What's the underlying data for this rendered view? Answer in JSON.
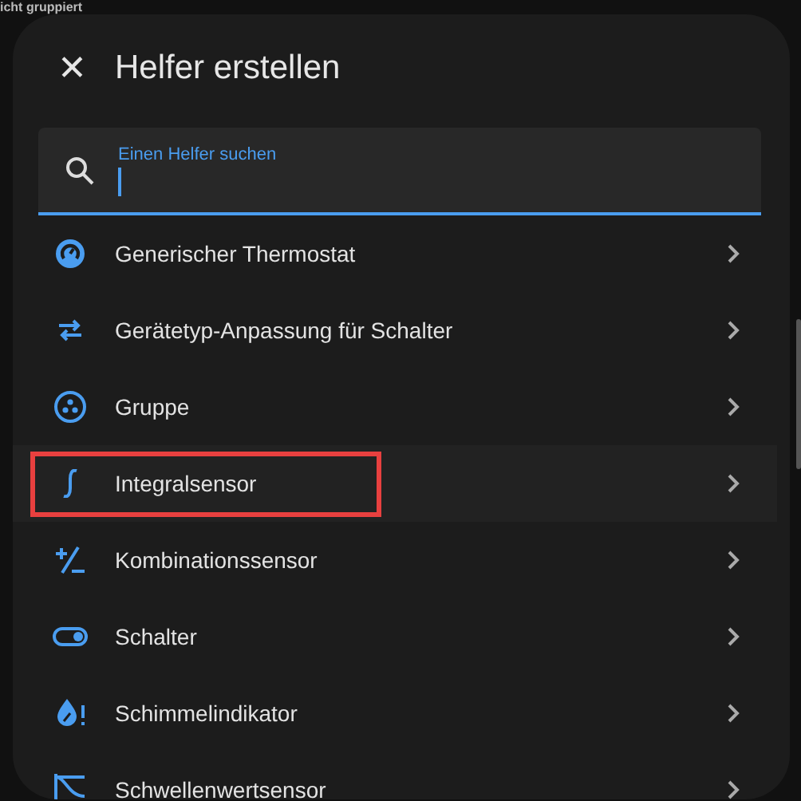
{
  "background_text": "icht gruppiert",
  "dialog": {
    "title": "Helfer erstellen",
    "close_label": "✕"
  },
  "search": {
    "placeholder": "Einen Helfer suchen",
    "focused": true
  },
  "items": [
    {
      "label": "Generischer Thermostat",
      "hovered": false,
      "highlighted": false
    },
    {
      "label": "Gerätetyp-Anpassung für Schalter",
      "hovered": false,
      "highlighted": false
    },
    {
      "label": "Gruppe",
      "hovered": false,
      "highlighted": false
    },
    {
      "label": "Integralsensor",
      "hovered": true,
      "highlighted": true
    },
    {
      "label": "Kombinationssensor",
      "hovered": false,
      "highlighted": false
    },
    {
      "label": "Schalter",
      "hovered": false,
      "highlighted": false
    },
    {
      "label": "Schimmelindikator",
      "hovered": false,
      "highlighted": false
    },
    {
      "label": "Schwellenwertsensor",
      "hovered": false,
      "highlighted": false
    }
  ]
}
